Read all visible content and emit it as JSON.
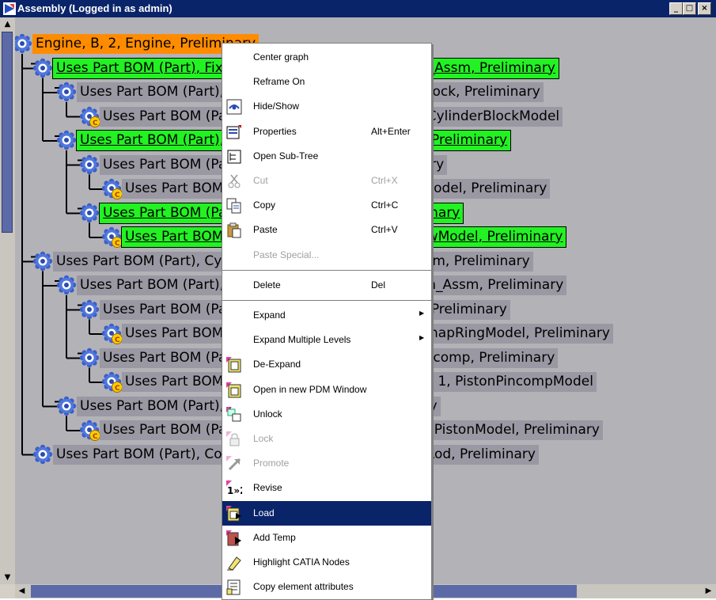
{
  "window": {
    "title": "Assembly (Logged in as admin)",
    "buttons": {
      "minimize": "_",
      "maximize": "□",
      "close": "×"
    }
  },
  "tree": {
    "nodes": [
      {
        "label": "Engine, B, 2, Engine, Preliminary",
        "status": "orange",
        "icon": "assembly-icon",
        "level": 0
      },
      {
        "label": "Uses Part BOM (Part), FixedParts_Assm, B, 2, FixedParts_Assm, Preliminary",
        "status": "green",
        "icon": "assembly-icon",
        "level": 1
      },
      {
        "label": "Uses Part BOM (Part), CylinderBlock, A, 1, CylinderBlock, Preliminary",
        "status": "gray",
        "icon": "assembly-icon",
        "level": 2
      },
      {
        "label": "Uses Part BOM (Part), CylinderBlockModel, A, 1, CylinderBlockModel",
        "status": "gray",
        "icon": "catia-part-icon",
        "level": 3
      },
      {
        "label": "Uses Part BOM (Part), Rack_Assm, B, 2, Rack_Assm, Preliminary",
        "status": "green",
        "icon": "assembly-icon",
        "level": 2
      },
      {
        "label": "Uses Part BOM (Part), Rack, A, 1, Rack, Preliminary",
        "status": "gray",
        "icon": "assembly-icon",
        "level": 3
      },
      {
        "label": "Uses Part BOM (Part), RackModel, A, 1, RackModel, Preliminary",
        "status": "gray",
        "icon": "catia-part-icon",
        "level": 4
      },
      {
        "label": "Uses Part BOM (Part), Screw, B, 2, Screw, Preliminary",
        "status": "green",
        "icon": "assembly-icon",
        "level": 3
      },
      {
        "label": "Uses Part BOM (Part), ScrewModel, B, 2, ScrewModel, Preliminary",
        "status": "green",
        "icon": "catia-part-icon",
        "level": 4
      },
      {
        "label": "Uses Part BOM (Part), Cylinder_Assm, A, 1, Cylinder_Assm, Preliminary",
        "status": "gray",
        "icon": "assembly-icon",
        "level": 1
      },
      {
        "label": "Uses Part BOM (Part), PistonPin_Assm, A, 1, PistonPin_Assm, Preliminary",
        "status": "gray",
        "icon": "assembly-icon",
        "level": 2
      },
      {
        "label": "Uses Part BOM (Part), SnapRing, A, 1, SnapRing, Preliminary",
        "status": "gray",
        "icon": "assembly-icon",
        "level": 3
      },
      {
        "label": "Uses Part BOM (Part), SnapRingModel, A, 1, SnapRingModel, Preliminary",
        "status": "gray",
        "icon": "catia-part-icon",
        "level": 4
      },
      {
        "label": "Uses Part BOM (Part), Pistoncomp, A, 1, PistonPincomp, Preliminary",
        "status": "gray",
        "icon": "assembly-icon",
        "level": 3
      },
      {
        "label": "Uses Part BOM (Part), PistonPincompModel, A, 1, PistonPincompModel",
        "status": "gray",
        "icon": "catia-part-icon",
        "level": 4
      },
      {
        "label": "Uses Part BOM (Part), Piston, A, 1, Piston, Preliminary",
        "status": "gray",
        "icon": "assembly-icon",
        "level": 2
      },
      {
        "label": "Uses Part BOM (Part), NewPistonModel, A, 1, NewPistonModel, Preliminary",
        "status": "gray",
        "icon": "catia-part-icon",
        "level": 3
      },
      {
        "label": "Uses Part BOM (Part), ConnectionRod, A, 1, ConnectionRod, Preliminary",
        "status": "gray",
        "icon": "assembly-icon",
        "level": 1
      }
    ]
  },
  "context_menu": {
    "items": [
      {
        "label": "Center graph",
        "shortcut": "",
        "icon": "",
        "enabled": true
      },
      {
        "label": "Reframe On",
        "shortcut": "",
        "icon": "",
        "enabled": true
      },
      {
        "label": "Hide/Show",
        "shortcut": "",
        "icon": "hide-show-icon",
        "enabled": true
      },
      {
        "label": "Properties",
        "shortcut": "Alt+Enter",
        "icon": "properties-icon",
        "enabled": true
      },
      {
        "label": "Open Sub-Tree",
        "shortcut": "",
        "icon": "subtree-icon",
        "enabled": true
      },
      {
        "label": "Cut",
        "shortcut": "Ctrl+X",
        "icon": "scissors-icon",
        "enabled": false
      },
      {
        "label": "Copy",
        "shortcut": "Ctrl+C",
        "icon": "copy-icon",
        "enabled": true
      },
      {
        "label": "Paste",
        "shortcut": "Ctrl+V",
        "icon": "paste-icon",
        "enabled": true
      },
      {
        "label": "Paste Special...",
        "shortcut": "",
        "icon": "",
        "enabled": false,
        "separator_after": true
      },
      {
        "label": "Delete",
        "shortcut": "Del",
        "icon": "",
        "enabled": true,
        "separator_after": true
      },
      {
        "label": "Expand",
        "shortcut": "",
        "icon": "",
        "enabled": true,
        "submenu": true
      },
      {
        "label": "Expand Multiple Levels",
        "shortcut": "",
        "icon": "",
        "enabled": true,
        "submenu": true
      },
      {
        "label": "De-Expand",
        "shortcut": "",
        "icon": "deexpand-icon",
        "enabled": true
      },
      {
        "label": "Open in new PDM Window",
        "shortcut": "",
        "icon": "pdm-window-icon",
        "enabled": true
      },
      {
        "label": "Unlock",
        "shortcut": "",
        "icon": "unlock-icon",
        "enabled": true
      },
      {
        "label": "Lock",
        "shortcut": "",
        "icon": "lock-icon",
        "enabled": false
      },
      {
        "label": "Promote",
        "shortcut": "",
        "icon": "promote-icon",
        "enabled": false
      },
      {
        "label": "Revise",
        "shortcut": "",
        "icon": "revise-icon",
        "enabled": true
      },
      {
        "label": "Load",
        "shortcut": "",
        "icon": "load-icon",
        "enabled": true,
        "highlighted": true
      },
      {
        "label": "Add Temp",
        "shortcut": "",
        "icon": "add-temp-icon",
        "enabled": true
      },
      {
        "label": "Highlight CATIA Nodes",
        "shortcut": "",
        "icon": "highlight-icon",
        "enabled": true
      },
      {
        "label": "Copy element attributes",
        "shortcut": "",
        "icon": "copy-attributes-icon",
        "enabled": true
      }
    ]
  },
  "colors": {
    "title_bar": "#0a246a",
    "tree_background": "#b3b2b7",
    "node_label_gray": "#9998a3",
    "node_label_green": "#22f222",
    "node_label_orange": "#ff8c00",
    "menu_highlight": "#0a246a"
  }
}
